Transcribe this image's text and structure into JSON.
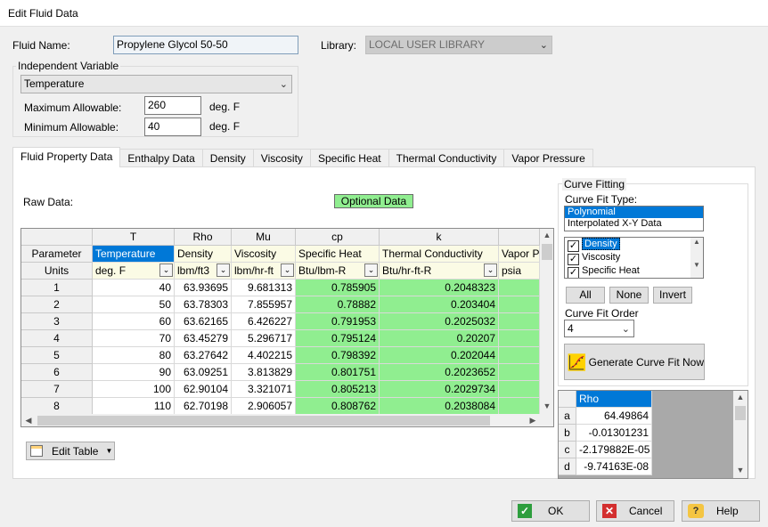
{
  "window": {
    "title": "Edit Fluid Data"
  },
  "fluid_name": {
    "label": "Fluid Name:",
    "value": "Propylene Glycol 50-50"
  },
  "library": {
    "label": "Library:",
    "value": "LOCAL USER LIBRARY"
  },
  "independent_variable": {
    "title": "Independent Variable",
    "selected": "Temperature",
    "max_label": "Maximum Allowable:",
    "max_value": "260",
    "max_unit": "deg. F",
    "min_label": "Minimum Allowable:",
    "min_value": "40",
    "min_unit": "deg. F"
  },
  "tabs": [
    {
      "label": "Fluid Property Data"
    },
    {
      "label": "Enthalpy Data"
    },
    {
      "label": "Density"
    },
    {
      "label": "Viscosity"
    },
    {
      "label": "Specific Heat"
    },
    {
      "label": "Thermal Conductivity"
    },
    {
      "label": "Vapor Pressure"
    }
  ],
  "raw_data_label": "Raw Data:",
  "optional_data_label": "Optional Data",
  "grid": {
    "symbols": [
      "T",
      "Rho",
      "Mu",
      "cp",
      "k"
    ],
    "parameter_label": "Parameter",
    "units_label": "Units",
    "parameters": [
      "Temperature",
      "Density",
      "Viscosity",
      "Specific Heat",
      "Thermal Conductivity",
      "Vapor Pr"
    ],
    "units": [
      "deg. F",
      "lbm/ft3",
      "lbm/hr-ft",
      "Btu/lbm-R",
      "Btu/hr-ft-R",
      "psia"
    ],
    "rows": [
      {
        "n": "1",
        "vals": [
          "40",
          "63.93695",
          "9.681313",
          "0.785905",
          "0.2048323"
        ]
      },
      {
        "n": "2",
        "vals": [
          "50",
          "63.78303",
          "7.855957",
          "0.78882",
          "0.203404"
        ]
      },
      {
        "n": "3",
        "vals": [
          "60",
          "63.62165",
          "6.426227",
          "0.791953",
          "0.2025032"
        ]
      },
      {
        "n": "4",
        "vals": [
          "70",
          "63.45279",
          "5.296717",
          "0.795124",
          "0.20207"
        ]
      },
      {
        "n": "5",
        "vals": [
          "80",
          "63.27642",
          "4.402215",
          "0.798392",
          "0.202044"
        ]
      },
      {
        "n": "6",
        "vals": [
          "90",
          "63.09251",
          "3.813829",
          "0.801751",
          "0.2023652"
        ]
      },
      {
        "n": "7",
        "vals": [
          "100",
          "62.90104",
          "3.321071",
          "0.805213",
          "0.2029734"
        ]
      },
      {
        "n": "8",
        "vals": [
          "110",
          "62.70198",
          "2.906057",
          "0.808762",
          "0.2038084"
        ]
      }
    ]
  },
  "edit_table_label": "Edit Table",
  "curve_fitting": {
    "title": "Curve Fitting",
    "type_label": "Curve Fit Type:",
    "types": [
      "Polynomial",
      "Interpolated X-Y Data"
    ],
    "properties": [
      "Density",
      "Viscosity",
      "Specific Heat"
    ],
    "all_label": "All",
    "none_label": "None",
    "invert_label": "Invert",
    "order_label": "Curve Fit Order",
    "order_value": "4",
    "generate_label": "Generate Curve Fit Now"
  },
  "coef_grid": {
    "header": "Rho",
    "rows": [
      {
        "k": "a",
        "v": "64.49864"
      },
      {
        "k": "b",
        "v": "-0.01301231"
      },
      {
        "k": "c",
        "v": "-2.179882E-05"
      },
      {
        "k": "d",
        "v": "-9.74163E-08"
      }
    ]
  },
  "footer": {
    "ok": "OK",
    "cancel": "Cancel",
    "help": "Help"
  },
  "colors": {
    "selection": "#0078d7",
    "green": "#90ee90",
    "param_row": "#fbfbe5"
  }
}
